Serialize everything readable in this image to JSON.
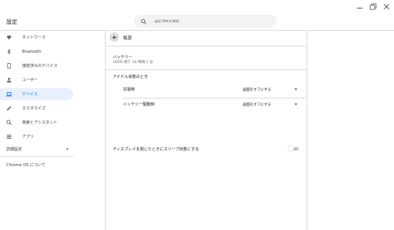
{
  "window": {
    "controls": [
      {
        "name": "minimize",
        "icon": "minimize-icon"
      },
      {
        "name": "restore",
        "icon": "restore-icon"
      },
      {
        "name": "close",
        "icon": "close-icon"
      }
    ]
  },
  "header": {
    "title": "設定",
    "search": {
      "placeholder": "設定項目を検索",
      "icon": "search-icon"
    }
  },
  "sidebar": {
    "items": [
      {
        "label": "ネットワーク",
        "icon": "wifi-icon",
        "active": false
      },
      {
        "label": "Bluetooth",
        "icon": "bluetooth-icon",
        "active": false
      },
      {
        "label": "接続済みのデバイス",
        "icon": "phone-icon",
        "active": false
      },
      {
        "label": "ユーザー",
        "icon": "person-icon",
        "active": false
      },
      {
        "label": "デバイス",
        "icon": "laptop-icon",
        "active": true
      },
      {
        "label": "カスタマイズ",
        "icon": "pen-icon",
        "active": false
      },
      {
        "label": "検索とアシスタント",
        "icon": "search-icon",
        "active": false
      },
      {
        "label": "アプリ",
        "icon": "apps-icon",
        "active": false
      }
    ],
    "advanced": {
      "label": "詳細設定",
      "icon": "chevron-down-icon"
    },
    "about": "Chrome OS について"
  },
  "main": {
    "title": "電源",
    "battery": {
      "label": "バッテリー",
      "status": "100% 残り 14 時間 1 分"
    },
    "idle": {
      "title": "アイドル状態のとき",
      "rows": [
        {
          "label": "充電時",
          "value": "画面をオフにする"
        },
        {
          "label": "バッテリー駆動時",
          "value": "画面をオフにする"
        }
      ]
    },
    "lid": {
      "label": "ディスプレイを閉じたときにスリープ状態にする",
      "enabled": false
    }
  },
  "colors": {
    "accent": "#1a73e8",
    "active_bg": "#e8f0fe",
    "divider": "#dadce0"
  }
}
